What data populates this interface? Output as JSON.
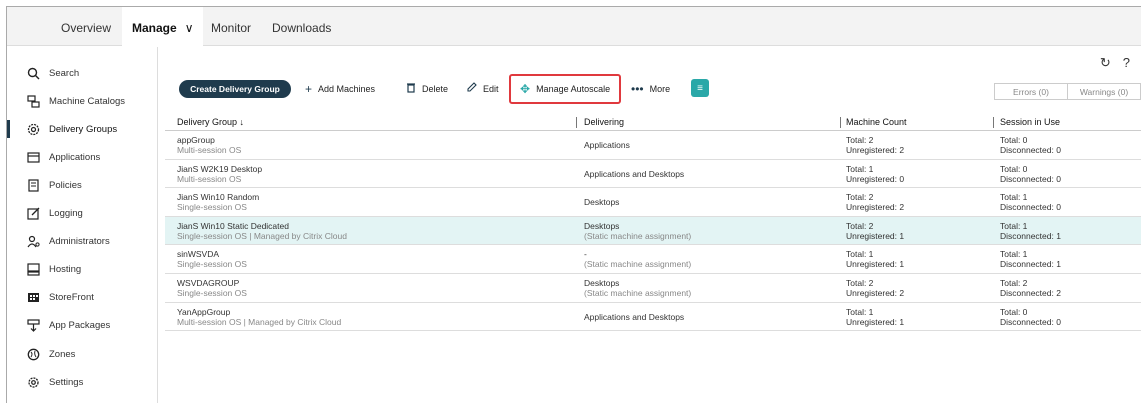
{
  "topnav": {
    "tabs": [
      "Overview",
      "Manage",
      "Monitor",
      "Downloads"
    ],
    "active_chevron": "∨"
  },
  "sidebar": {
    "items": [
      {
        "label": "Search",
        "icon": "search-icon"
      },
      {
        "label": "Machine Catalogs",
        "icon": "machine-catalogs-icon"
      },
      {
        "label": "Delivery Groups",
        "icon": "delivery-groups-icon"
      },
      {
        "label": "Applications",
        "icon": "applications-icon"
      },
      {
        "label": "Policies",
        "icon": "policies-icon"
      },
      {
        "label": "Logging",
        "icon": "logging-icon"
      },
      {
        "label": "Administrators",
        "icon": "administrators-icon"
      },
      {
        "label": "Hosting",
        "icon": "hosting-icon"
      },
      {
        "label": "StoreFront",
        "icon": "storefront-icon"
      },
      {
        "label": "App Packages",
        "icon": "app-packages-icon"
      },
      {
        "label": "Zones",
        "icon": "zones-icon"
      },
      {
        "label": "Settings",
        "icon": "settings-icon"
      }
    ]
  },
  "toolbar": {
    "create": "Create Delivery Group",
    "add_machines": "Add Machines",
    "delete": "Delete",
    "edit": "Edit",
    "manage_autoscale": "Manage Autoscale",
    "more": "More",
    "errors": "Errors (0)",
    "warnings": "Warnings (0)"
  },
  "table": {
    "headers": [
      "Delivery Group ↓",
      "Delivering",
      "Machine Count",
      "Session in Use"
    ],
    "rows": [
      {
        "name": "appGroup",
        "sub": "Multi-session OS",
        "deliv1": "Applications",
        "deliv2": "",
        "mc1": "Total: 2",
        "mc2": "Unregistered: 2",
        "su1": "Total: 0",
        "su2": "Disconnected: 0"
      },
      {
        "name": "JianS W2K19 Desktop",
        "sub": "Multi-session OS",
        "deliv1": "Applications and Desktops",
        "deliv2": "",
        "mc1": "Total: 1",
        "mc2": "Unregistered: 0",
        "su1": "Total: 0",
        "su2": "Disconnected: 0"
      },
      {
        "name": "JianS Win10 Random",
        "sub": "Single-session OS",
        "deliv1": "Desktops",
        "deliv2": "",
        "mc1": "Total: 2",
        "mc2": "Unregistered: 2",
        "su1": "Total: 1",
        "su2": "Disconnected: 0"
      },
      {
        "name": "JianS Win10 Static Dedicated",
        "sub": "Single-session OS | Managed by Citrix Cloud",
        "deliv1": "Desktops",
        "deliv2": "(Static machine assignment)",
        "mc1": "Total: 2",
        "mc2": "Unregistered: 1",
        "su1": "Total: 1",
        "su2": "Disconnected: 1"
      },
      {
        "name": "sinWSVDA",
        "sub": "Single-session OS",
        "deliv1": "-",
        "deliv2": "(Static machine assignment)",
        "mc1": "Total: 1",
        "mc2": "Unregistered: 1",
        "su1": "Total: 1",
        "su2": "Disconnected: 1"
      },
      {
        "name": "WSVDAGROUP",
        "sub": "Single-session OS",
        "deliv1": "Desktops",
        "deliv2": "(Static machine assignment)",
        "mc1": "Total: 2",
        "mc2": "Unregistered: 2",
        "su1": "Total: 2",
        "su2": "Disconnected: 2"
      },
      {
        "name": "YanAppGroup",
        "sub": "Multi-session OS | Managed by Citrix Cloud",
        "deliv1": "Applications and Desktops",
        "deliv2": "",
        "mc1": "Total: 1",
        "mc2": "Unregistered: 1",
        "su1": "Total: 0",
        "su2": "Disconnected: 0"
      }
    ]
  },
  "colors": {
    "accent": "#1f3b4d",
    "selected_row": "#e3f4f4",
    "highlight": "#e0393e",
    "chat": "#2aa8a8"
  }
}
